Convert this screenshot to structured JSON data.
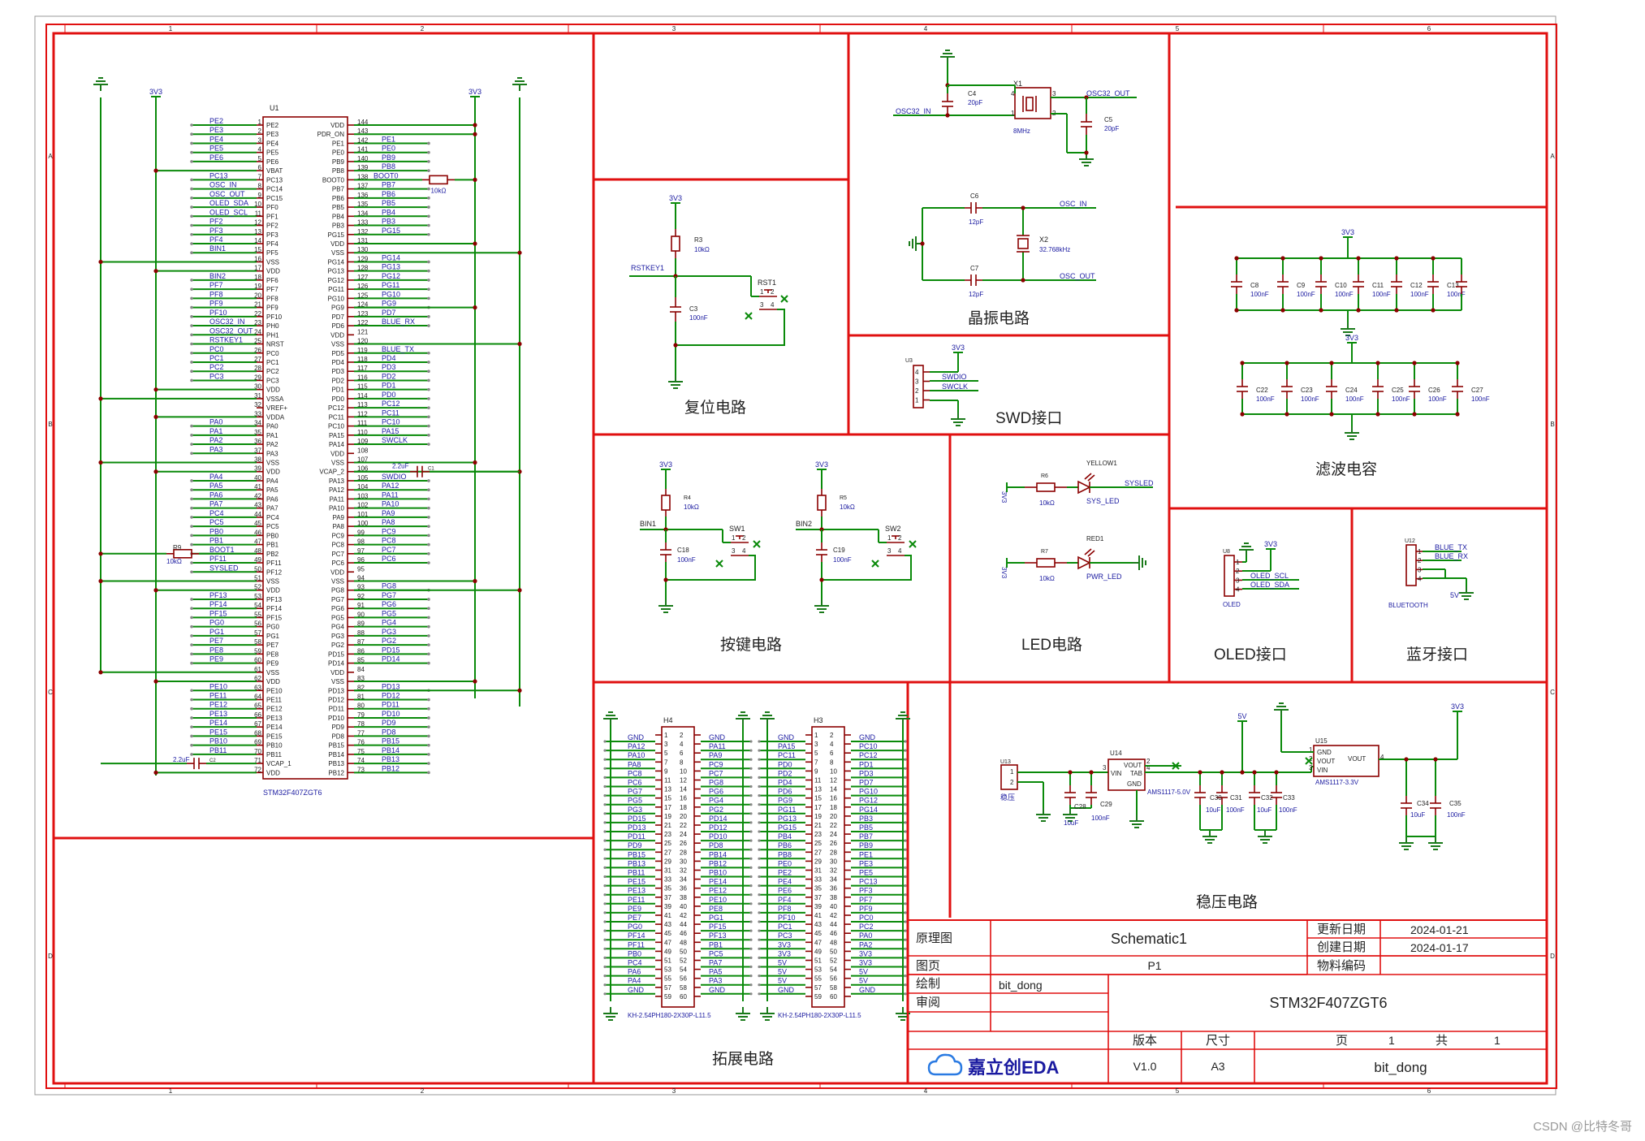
{
  "header": {
    "col_markers": [
      "1",
      "2",
      "3",
      "4",
      "5",
      "6"
    ],
    "row_markers": [
      "A",
      "B",
      "C",
      "D"
    ]
  },
  "mcu": {
    "ref": "U1",
    "part": "STM32F407ZGT6",
    "left_pins": [
      {
        "num": "1",
        "name": "PE2",
        "net": "PE2"
      },
      {
        "num": "2",
        "name": "PE3",
        "net": "PE3"
      },
      {
        "num": "3",
        "name": "PE4",
        "net": "PE4"
      },
      {
        "num": "4",
        "name": "PE5",
        "net": "PE5"
      },
      {
        "num": "5",
        "name": "PE6",
        "net": "PE6"
      },
      {
        "num": "6",
        "name": "VBAT",
        "net": ""
      },
      {
        "num": "7",
        "name": "PC13",
        "net": "PC13"
      },
      {
        "num": "8",
        "name": "PC14",
        "net": "OSC_IN"
      },
      {
        "num": "9",
        "name": "PC15",
        "net": "OSC_OUT"
      },
      {
        "num": "10",
        "name": "PF0",
        "net": "OLED_SDA"
      },
      {
        "num": "11",
        "name": "PF1",
        "net": "OLED_SCL"
      },
      {
        "num": "12",
        "name": "PF2",
        "net": "PF2"
      },
      {
        "num": "13",
        "name": "PF3",
        "net": "PF3"
      },
      {
        "num": "14",
        "name": "PF4",
        "net": "PF4"
      },
      {
        "num": "15",
        "name": "PF5",
        "net": "BIN1"
      },
      {
        "num": "16",
        "name": "VSS",
        "net": ""
      },
      {
        "num": "17",
        "name": "VDD",
        "net": ""
      },
      {
        "num": "18",
        "name": "PF6",
        "net": "BIN2"
      },
      {
        "num": "19",
        "name": "PF7",
        "net": "PF7"
      },
      {
        "num": "20",
        "name": "PF8",
        "net": "PF8"
      },
      {
        "num": "21",
        "name": "PF9",
        "net": "PF9"
      },
      {
        "num": "22",
        "name": "PF10",
        "net": "PF10"
      },
      {
        "num": "23",
        "name": "PH0",
        "net": "OSC32_IN"
      },
      {
        "num": "24",
        "name": "PH1",
        "net": "OSC32_OUT"
      },
      {
        "num": "25",
        "name": "NRST",
        "net": "RSTKEY1"
      },
      {
        "num": "26",
        "name": "PC0",
        "net": "PC0"
      },
      {
        "num": "27",
        "name": "PC1",
        "net": "PC1"
      },
      {
        "num": "28",
        "name": "PC2",
        "net": "PC2"
      },
      {
        "num": "29",
        "name": "PC3",
        "net": "PC3"
      },
      {
        "num": "30",
        "name": "VDD",
        "net": ""
      },
      {
        "num": "31",
        "name": "VSSA",
        "net": ""
      },
      {
        "num": "32",
        "name": "VREF+",
        "net": ""
      },
      {
        "num": "33",
        "name": "VDDA",
        "net": ""
      },
      {
        "num": "34",
        "name": "PA0",
        "net": "PA0"
      },
      {
        "num": "35",
        "name": "PA1",
        "net": "PA1"
      },
      {
        "num": "36",
        "name": "PA2",
        "net": "PA2"
      },
      {
        "num": "37",
        "name": "PA3",
        "net": "PA3"
      },
      {
        "num": "38",
        "name": "VSS",
        "net": ""
      },
      {
        "num": "39",
        "name": "VDD",
        "net": ""
      },
      {
        "num": "40",
        "name": "PA4",
        "net": "PA4"
      },
      {
        "num": "41",
        "name": "PA5",
        "net": "PA5"
      },
      {
        "num": "42",
        "name": "PA6",
        "net": "PA6"
      },
      {
        "num": "43",
        "name": "PA7",
        "net": "PA7"
      },
      {
        "num": "44",
        "name": "PC4",
        "net": "PC4"
      },
      {
        "num": "45",
        "name": "PC5",
        "net": "PC5"
      },
      {
        "num": "46",
        "name": "PB0",
        "net": "PB0"
      },
      {
        "num": "47",
        "name": "PB1",
        "net": "PB1"
      },
      {
        "num": "48",
        "name": "PB2",
        "net": "BOOT1"
      },
      {
        "num": "49",
        "name": "PF11",
        "net": "PF11"
      },
      {
        "num": "50",
        "name": "PF12",
        "net": "SYSLED"
      },
      {
        "num": "51",
        "name": "VSS",
        "net": ""
      },
      {
        "num": "52",
        "name": "VDD",
        "net": ""
      },
      {
        "num": "53",
        "name": "PF13",
        "net": "PF13"
      },
      {
        "num": "54",
        "name": "PF14",
        "net": "PF14"
      },
      {
        "num": "55",
        "name": "PF15",
        "net": "PF15"
      },
      {
        "num": "56",
        "name": "PG0",
        "net": "PG0"
      },
      {
        "num": "57",
        "name": "PG1",
        "net": "PG1"
      },
      {
        "num": "58",
        "name": "PE7",
        "net": "PE7"
      },
      {
        "num": "59",
        "name": "PE8",
        "net": "PE8"
      },
      {
        "num": "60",
        "name": "PE9",
        "net": "PE9"
      },
      {
        "num": "61",
        "name": "VSS",
        "net": ""
      },
      {
        "num": "62",
        "name": "VDD",
        "net": ""
      },
      {
        "num": "63",
        "name": "PE10",
        "net": "PE10"
      },
      {
        "num": "64",
        "name": "PE11",
        "net": "PE11"
      },
      {
        "num": "65",
        "name": "PE12",
        "net": "PE12"
      },
      {
        "num": "66",
        "name": "PE13",
        "net": "PE13"
      },
      {
        "num": "67",
        "name": "PE14",
        "net": "PE14"
      },
      {
        "num": "68",
        "name": "PE15",
        "net": "PE15"
      },
      {
        "num": "69",
        "name": "PB10",
        "net": "PB10"
      },
      {
        "num": "70",
        "name": "PB11",
        "net": "PB11"
      },
      {
        "num": "71",
        "name": "VCAP_1",
        "net": ""
      },
      {
        "num": "72",
        "name": "VDD",
        "net": ""
      }
    ],
    "right_pins": [
      {
        "num": "144",
        "name": "VDD",
        "net": ""
      },
      {
        "num": "143",
        "name": "PDR_ON",
        "net": ""
      },
      {
        "num": "142",
        "name": "PE1",
        "net": "PE1"
      },
      {
        "num": "141",
        "name": "PE0",
        "net": "PE0"
      },
      {
        "num": "140",
        "name": "PB9",
        "net": "PB9"
      },
      {
        "num": "139",
        "name": "PB8",
        "net": "PB8"
      },
      {
        "num": "138",
        "name": "BOOT0",
        "net": "BOOT0"
      },
      {
        "num": "137",
        "name": "PB7",
        "net": "PB7"
      },
      {
        "num": "136",
        "name": "PB6",
        "net": "PB6"
      },
      {
        "num": "135",
        "name": "PB5",
        "net": "PB5"
      },
      {
        "num": "134",
        "name": "PB4",
        "net": "PB4"
      },
      {
        "num": "133",
        "name": "PB3",
        "net": "PB3"
      },
      {
        "num": "132",
        "name": "PG15",
        "net": "PG15"
      },
      {
        "num": "131",
        "name": "VDD",
        "net": ""
      },
      {
        "num": "130",
        "name": "VSS",
        "net": ""
      },
      {
        "num": "129",
        "name": "PG14",
        "net": "PG14"
      },
      {
        "num": "128",
        "name": "PG13",
        "net": "PG13"
      },
      {
        "num": "127",
        "name": "PG12",
        "net": "PG12"
      },
      {
        "num": "126",
        "name": "PG11",
        "net": "PG11"
      },
      {
        "num": "125",
        "name": "PG10",
        "net": "PG10"
      },
      {
        "num": "124",
        "name": "PG9",
        "net": "PG9"
      },
      {
        "num": "123",
        "name": "PD7",
        "net": "PD7"
      },
      {
        "num": "122",
        "name": "PD6",
        "net": "BLUE_RX"
      },
      {
        "num": "121",
        "name": "VDD",
        "net": ""
      },
      {
        "num": "120",
        "name": "VSS",
        "net": ""
      },
      {
        "num": "119",
        "name": "PD5",
        "net": "BLUE_TX"
      },
      {
        "num": "118",
        "name": "PD4",
        "net": "PD4"
      },
      {
        "num": "117",
        "name": "PD3",
        "net": "PD3"
      },
      {
        "num": "116",
        "name": "PD2",
        "net": "PD2"
      },
      {
        "num": "115",
        "name": "PD1",
        "net": "PD1"
      },
      {
        "num": "114",
        "name": "PD0",
        "net": "PD0"
      },
      {
        "num": "113",
        "name": "PC12",
        "net": "PC12"
      },
      {
        "num": "112",
        "name": "PC11",
        "net": "PC11"
      },
      {
        "num": "111",
        "name": "PC10",
        "net": "PC10"
      },
      {
        "num": "110",
        "name": "PA15",
        "net": "PA15"
      },
      {
        "num": "109",
        "name": "PA14",
        "net": "SWCLK"
      },
      {
        "num": "108",
        "name": "VDD",
        "net": ""
      },
      {
        "num": "107",
        "name": "VSS",
        "net": ""
      },
      {
        "num": "106",
        "name": "VCAP_2",
        "net": "2.2uF"
      },
      {
        "num": "105",
        "name": "PA13",
        "net": "SWDIO"
      },
      {
        "num": "104",
        "name": "PA12",
        "net": "PA12"
      },
      {
        "num": "103",
        "name": "PA11",
        "net": "PA11"
      },
      {
        "num": "102",
        "name": "PA10",
        "net": "PA10"
      },
      {
        "num": "101",
        "name": "PA9",
        "net": "PA9"
      },
      {
        "num": "100",
        "name": "PA8",
        "net": "PA8"
      },
      {
        "num": "99",
        "name": "PC9",
        "net": "PC9"
      },
      {
        "num": "98",
        "name": "PC8",
        "net": "PC8"
      },
      {
        "num": "97",
        "name": "PC7",
        "net": "PC7"
      },
      {
        "num": "96",
        "name": "PC6",
        "net": "PC6"
      },
      {
        "num": "95",
        "name": "VDD",
        "net": ""
      },
      {
        "num": "94",
        "name": "VSS",
        "net": ""
      },
      {
        "num": "93",
        "name": "PG8",
        "net": "PG8"
      },
      {
        "num": "92",
        "name": "PG7",
        "net": "PG7"
      },
      {
        "num": "91",
        "name": "PG6",
        "net": "PG6"
      },
      {
        "num": "90",
        "name": "PG5",
        "net": "PG5"
      },
      {
        "num": "89",
        "name": "PG4",
        "net": "PG4"
      },
      {
        "num": "88",
        "name": "PG3",
        "net": "PG3"
      },
      {
        "num": "87",
        "name": "PG2",
        "net": "PG2"
      },
      {
        "num": "86",
        "name": "PD15",
        "net": "PD15"
      },
      {
        "num": "85",
        "name": "PD14",
        "net": "PD14"
      },
      {
        "num": "84",
        "name": "VDD",
        "net": ""
      },
      {
        "num": "83",
        "name": "VSS",
        "net": ""
      },
      {
        "num": "82",
        "name": "PD13",
        "net": "PD13"
      },
      {
        "num": "81",
        "name": "PD12",
        "net": "PD12"
      },
      {
        "num": "80",
        "name": "PD11",
        "net": "PD11"
      },
      {
        "num": "79",
        "name": "PD10",
        "net": "PD10"
      },
      {
        "num": "78",
        "name": "PD9",
        "net": "PD9"
      },
      {
        "num": "77",
        "name": "PD8",
        "net": "PD8"
      },
      {
        "num": "76",
        "name": "PB15",
        "net": "PB15"
      },
      {
        "num": "75",
        "name": "PB14",
        "net": "PB14"
      },
      {
        "num": "74",
        "name": "PB13",
        "net": "PB13"
      },
      {
        "num": "73",
        "name": "PB12",
        "net": "PB12"
      }
    ],
    "r_boot0": {
      "ref": "",
      "value": "10kΩ"
    },
    "r_boot1": {
      "ref": "R9",
      "value": "10kΩ"
    },
    "c_vcap2": {
      "ref": "C1",
      "value": "2.2uF"
    },
    "c_vcap1": {
      "ref": "C2",
      "value": "2.2uF"
    },
    "power": "3V3"
  },
  "reset": {
    "title": "复位电路",
    "power": "3V3",
    "r": {
      "ref": "R3",
      "value": "10kΩ"
    },
    "c": {
      "ref": "C3",
      "value": "100nF"
    },
    "net": "RSTKEY1",
    "sw": "RST1",
    "pins": [
      "1",
      "2",
      "3",
      "4"
    ]
  },
  "crystal": {
    "title": "晶振电路",
    "x1": {
      "ref": "X1",
      "value": "8MHz",
      "net_in": "OSC32_IN",
      "net_out": "OSC32_OUT"
    },
    "c4": {
      "ref": "C4",
      "value": "20pF"
    },
    "c5": {
      "ref": "C5",
      "value": "20pF"
    },
    "x2": {
      "ref": "X2",
      "value": "32.768kHz",
      "net_in": "OSC_IN",
      "net_out": "OSC_OUT"
    },
    "c6": {
      "ref": "C6",
      "value": "12pF"
    },
    "c7": {
      "ref": "C7",
      "value": "12pF"
    },
    "pins": [
      "1",
      "2",
      "3",
      "4"
    ]
  },
  "swd": {
    "title": "SWD接口",
    "ref": "U3",
    "power": "3V3",
    "nets": [
      "SWDIO",
      "SWCLK"
    ],
    "pins": [
      "4",
      "3",
      "2",
      "1"
    ]
  },
  "filter": {
    "title": "滤波电容",
    "power": "3V3",
    "row1": [
      {
        "ref": "C8",
        "value": "100nF"
      },
      {
        "ref": "C9",
        "value": "100nF"
      },
      {
        "ref": "C10",
        "value": "100nF"
      },
      {
        "ref": "C11",
        "value": "100nF"
      },
      {
        "ref": "C12",
        "value": "100nF"
      },
      {
        "ref": "C13",
        "value": "100nF"
      }
    ],
    "row2": [
      {
        "ref": "C22",
        "value": "100nF"
      },
      {
        "ref": "C23",
        "value": "100nF"
      },
      {
        "ref": "C24",
        "value": "100nF"
      },
      {
        "ref": "C25",
        "value": "100nF"
      },
      {
        "ref": "C26",
        "value": "100nF"
      },
      {
        "ref": "C27",
        "value": "100nF"
      }
    ]
  },
  "keys": {
    "title": "按键电路",
    "k1": {
      "power": "3V3",
      "r": {
        "ref": "R4",
        "value": "10kΩ"
      },
      "c": {
        "ref": "C18",
        "value": "100nF"
      },
      "net": "BIN1",
      "sw": "SW1"
    },
    "k2": {
      "power": "3V3",
      "r": {
        "ref": "R5",
        "value": "10kΩ"
      },
      "c": {
        "ref": "C19",
        "value": "100nF"
      },
      "net": "BIN2",
      "sw": "SW2"
    },
    "pins": [
      "1",
      "2",
      "3",
      "4"
    ]
  },
  "led": {
    "title": "LED电路",
    "led1": {
      "power": "3V3",
      "r": {
        "ref": "R6",
        "value": "10kΩ"
      },
      "led": "YELLOW1",
      "label": "SYS_LED",
      "net": "SYSLED"
    },
    "led2": {
      "power": "3V3",
      "r": {
        "ref": "R7",
        "value": "10kΩ"
      },
      "led": "RED1",
      "label": "PWR_LED"
    }
  },
  "oled": {
    "title": "OLED接口",
    "ref": "U8",
    "name": "OLED",
    "power": "3V3",
    "nets": [
      "OLED_SCL",
      "OLED_SDA"
    ],
    "pins": [
      "1",
      "2",
      "3",
      "4"
    ]
  },
  "bluetooth": {
    "title": "蓝牙接口",
    "ref": "U12",
    "name": "BLUETOOTH",
    "power": "5V",
    "nets": [
      "BLUE_TX",
      "BLUE_RX"
    ],
    "pins": [
      "1",
      "2",
      "3",
      "4"
    ]
  },
  "expansion": {
    "title": "拓展电路",
    "h4": {
      "ref": "H4",
      "part": "KH-2.54PH180-2X30P-L11.5",
      "left": [
        "GND",
        "PA12",
        "PA10",
        "PA8",
        "PC8",
        "PC6",
        "PG7",
        "PG5",
        "PG3",
        "PD15",
        "PD13",
        "PD11",
        "PD9",
        "PB15",
        "PB13",
        "PB11",
        "PE15",
        "PE13",
        "PE11",
        "PE9",
        "PE7",
        "PG0",
        "PF14",
        "PF11",
        "PB0",
        "PC4",
        "PA6",
        "PA4",
        "GND"
      ],
      "right": [
        "GND",
        "PA11",
        "PA9",
        "PC9",
        "PC7",
        "PG8",
        "PG6",
        "PG4",
        "PG2",
        "PD14",
        "PD12",
        "PD10",
        "PD8",
        "PB14",
        "PB12",
        "PB10",
        "PE14",
        "PE12",
        "PE10",
        "PE8",
        "PG1",
        "PF15",
        "PF13",
        "PB1",
        "PC5",
        "PA7",
        "PA5",
        "PA3",
        "GND"
      ]
    },
    "h3": {
      "ref": "H3",
      "part": "KH-2.54PH180-2X30P-L11.5",
      "left": [
        "GND",
        "PA15",
        "PC11",
        "PD0",
        "PD2",
        "PD4",
        "PD6",
        "PG9",
        "PG11",
        "PG13",
        "PG15",
        "PB4",
        "PB6",
        "PB8",
        "PE0",
        "PE2",
        "PE4",
        "PE6",
        "PF4",
        "PF8",
        "PF10",
        "PC1",
        "PC3",
        "3V3",
        "3V3",
        "5V",
        "5V",
        "5V",
        "GND"
      ],
      "right": [
        "GND",
        "PC10",
        "PC12",
        "PD1",
        "PD3",
        "PD7",
        "PG10",
        "PG12",
        "PG14",
        "PB3",
        "PB5",
        "PB7",
        "PB9",
        "PE1",
        "PE3",
        "PE5",
        "PC13",
        "PF3",
        "PF7",
        "PF9",
        "PC0",
        "PC2",
        "PA0",
        "PA2",
        "3V3",
        "3V3",
        "5V",
        "5V",
        "GND"
      ]
    }
  },
  "regulator": {
    "title": "稳压电路",
    "u13": {
      "ref": "U13",
      "name": "稳压",
      "pins": [
        "1",
        "2"
      ]
    },
    "u14": {
      "ref": "U14",
      "part": "AMS1117-5.0V",
      "pins": {
        "vin": "VIN",
        "gnd": "GND",
        "vout": "VOUT",
        "tab": "TAB"
      },
      "nums": [
        "3",
        "1",
        "2",
        "4"
      ]
    },
    "u15": {
      "ref": "U15",
      "part": "AMS1117-3.3V",
      "pins": {
        "gnd": "GND",
        "vout": "VOUT",
        "vin": "VIN",
        "vout2": "VOUT"
      },
      "nums": [
        "1",
        "2",
        "3",
        "4"
      ]
    },
    "caps": [
      {
        "ref": "C28",
        "value": "10uF"
      },
      {
        "ref": "C29",
        "value": "100nF"
      },
      {
        "ref": "C30",
        "value": "10uF"
      },
      {
        "ref": "C31",
        "value": "100nF"
      },
      {
        "ref": "C32",
        "value": "10uF"
      },
      {
        "ref": "C33",
        "value": "100nF"
      },
      {
        "ref": "C34",
        "value": "10uF"
      },
      {
        "ref": "C35",
        "value": "100nF"
      }
    ],
    "p5v": "5V",
    "p3v3": "3V3"
  },
  "title_block": {
    "lbl_schematic": "原理图",
    "schematic_name": "Schematic1",
    "lbl_update": "更新日期",
    "update_date": "2024-01-21",
    "lbl_sheet": "图页",
    "sheet": "P1",
    "lbl_create": "创建日期",
    "create_date": "2024-01-17",
    "lbl_partno": "物料编码",
    "lbl_drawn": "绘制",
    "drawn_by": "bit_dong",
    "lbl_review": "审阅",
    "title": "STM32F407ZGT6",
    "lbl_version": "版本",
    "lbl_size": "尺寸",
    "lbl_page": "页",
    "page_num": "1",
    "lbl_total": "共",
    "total_pages": "1",
    "brand": "嘉立创EDA",
    "version": "V1.0",
    "size": "A3",
    "company": "bit_dong"
  },
  "watermark": "CSDN @比特冬哥"
}
